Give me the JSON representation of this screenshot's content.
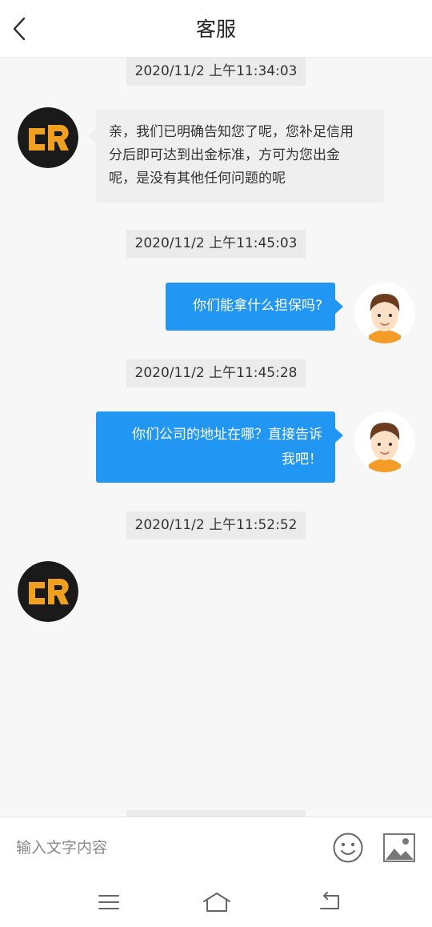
{
  "header": {
    "title": "客服"
  },
  "messages": [
    {
      "time": "2020/11/2 上午11:34:03",
      "from": "agent",
      "lines": [
        "亲，我们已明确告知您了呢，您补足信用",
        "分后即可达到出金标准，方可为您出金",
        "呢，是没有其他任何问题的呢"
      ]
    },
    {
      "time": "2020/11/2 上午11:45:03",
      "from": "user",
      "lines": [
        "你们能拿什么担保吗?"
      ]
    },
    {
      "time": "2020/11/2 上午11:45:28",
      "from": "user",
      "lines": [
        "你们公司的地址在哪？直接告诉",
        "我吧！"
      ]
    },
    {
      "time": "2020/11/2 上午11:52:52",
      "from": "agent",
      "lines": []
    }
  ],
  "input": {
    "placeholder": "输入文字内容"
  },
  "colors": {
    "user_bubble": "#2196f3",
    "agent_bubble": "#efefef",
    "brand_orange": "#f0a020",
    "brand_dark": "#1a1a1a"
  },
  "icons": {
    "back": "chevron-left-icon",
    "emoji": "smiley-icon",
    "image": "image-icon",
    "menu": "menu-icon",
    "home": "home-icon",
    "return": "return-icon"
  }
}
